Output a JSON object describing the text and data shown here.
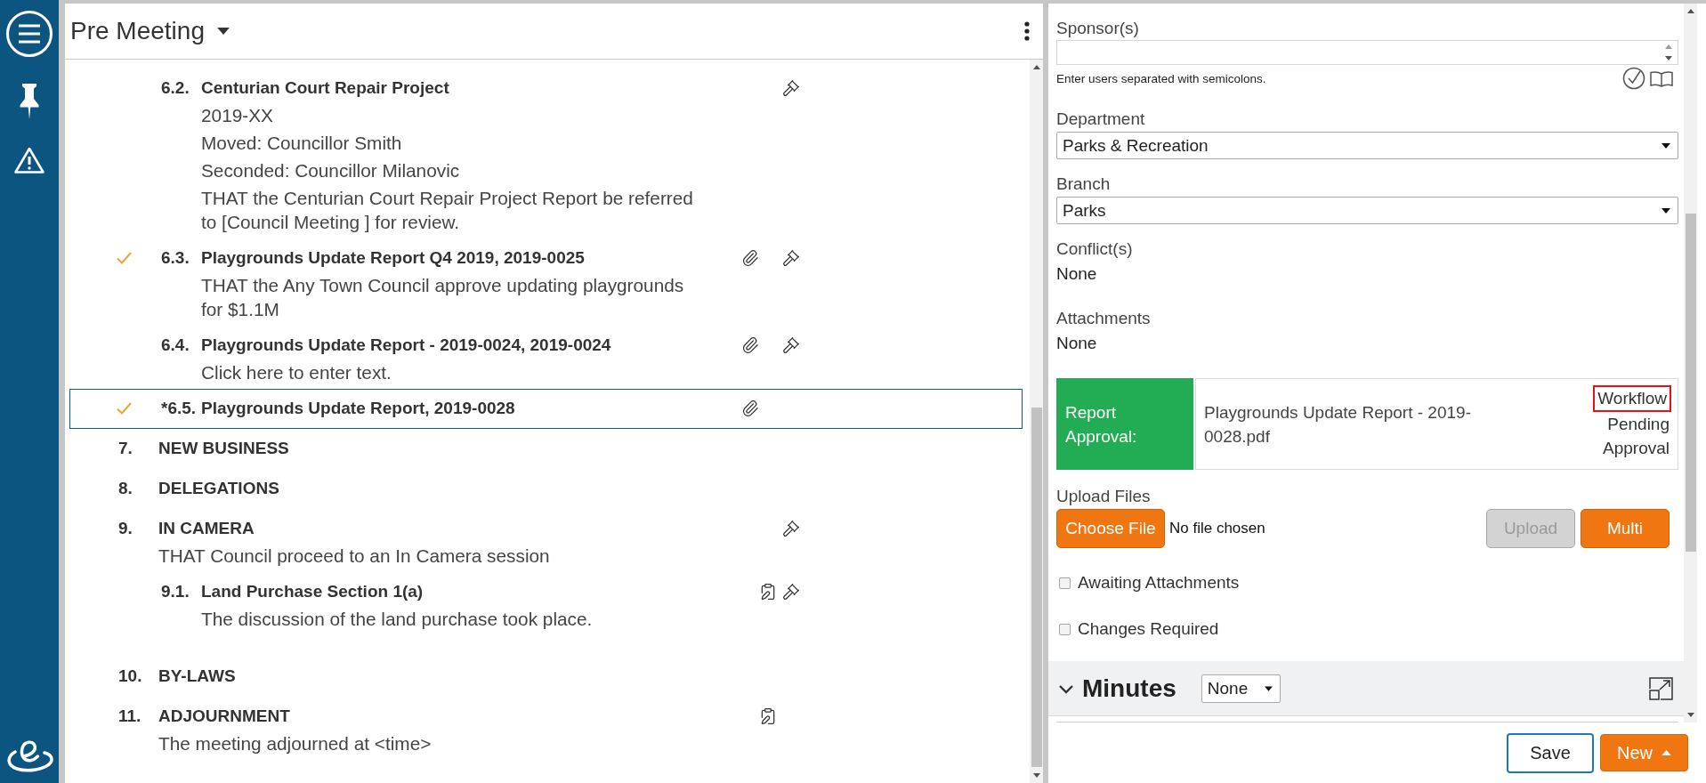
{
  "agenda": {
    "title": "Pre Meeting",
    "continued_subitems": [
      {
        "number": "6.2.",
        "title": "Centurian Court Repair Project",
        "lines": [
          "2019-XX",
          "Moved: Councillor Smith",
          "Seconded: Councillor Milanovic",
          "THAT the Centurian Court Repair Project Report be referred to [Council Meeting ] for review."
        ],
        "checked": false,
        "selected": false,
        "attachment": false,
        "minutes": false,
        "motion": true
      },
      {
        "number": "6.3.",
        "title": "Playgrounds Update Report Q4 2019, 2019-0025",
        "lines": [
          "THAT the Any Town Council approve updating playgrounds for $1.1M"
        ],
        "checked": true,
        "selected": false,
        "attachment": true,
        "minutes": false,
        "motion": true
      },
      {
        "number": "6.4.",
        "title": "Playgrounds Update Report - 2019-0024, 2019-0024",
        "lines": [
          "Click here to enter text."
        ],
        "checked": false,
        "selected": false,
        "attachment": true,
        "minutes": false,
        "motion": true
      },
      {
        "number": "*6.5.",
        "title": "Playgrounds Update Report, 2019-0028",
        "checked": true,
        "selected": true,
        "attachment": true,
        "minutes": false,
        "motion": false
      }
    ],
    "items": [
      {
        "number": "7.",
        "title": "NEW BUSINESS",
        "checked": false,
        "selected": false,
        "attachment": false,
        "minutes": false,
        "motion": false
      },
      {
        "number": "8.",
        "title": "DELEGATIONS",
        "checked": false,
        "selected": false,
        "attachment": false,
        "minutes": false,
        "motion": false
      },
      {
        "number": "9.",
        "title": "IN CAMERA",
        "lines": [
          "THAT Council proceed to an In Camera session"
        ],
        "checked": false,
        "selected": false,
        "attachment": false,
        "minutes": false,
        "motion": true,
        "children": [
          {
            "number": "9.1.",
            "title": "Land Purchase Section 1(a)",
            "lines": [
              "The discussion of the land purchase took place."
            ],
            "checked": false,
            "selected": false,
            "attachment": false,
            "minutes": true,
            "motion": true
          }
        ]
      },
      {
        "number": "10.",
        "title": "BY-LAWS",
        "checked": false,
        "selected": false,
        "attachment": false,
        "minutes": false,
        "motion": false
      },
      {
        "number": "11.",
        "title": "ADJOURNMENT",
        "lines": [
          "The meeting adjourned at <time>"
        ],
        "checked": false,
        "selected": false,
        "attachment": false,
        "minutes": true,
        "motion": false
      }
    ]
  },
  "details": {
    "fields": [
      {
        "kind": "users",
        "label": "Sponsor(s)",
        "hint": "Enter users separated with semicolons."
      },
      {
        "kind": "select",
        "label": "Department",
        "value": "Parks & Recreation"
      },
      {
        "kind": "select",
        "label": "Branch",
        "value": "Parks"
      },
      {
        "kind": "text",
        "label": "Conflict(s)",
        "value": "None"
      },
      {
        "kind": "text",
        "label": "Attachments",
        "value": "None"
      }
    ],
    "approval": {
      "label": "Report Approval:",
      "file": "Playgrounds Update Report - 2019-0028.pdf",
      "workflow": {
        "label": "Workflow",
        "highlighted": true
      },
      "status": "Pending Approval"
    },
    "upload": {
      "label": "Upload Files",
      "choose_button": "Choose File",
      "file_status": "No file chosen",
      "buttons": [
        {
          "label": "Upload",
          "disabled": true
        },
        {
          "label": "Multi",
          "disabled": false
        }
      ]
    },
    "checkboxes": [
      {
        "label": "Awaiting Attachments",
        "checked": false
      },
      {
        "label": "Changes Required",
        "checked": false
      }
    ],
    "minutes": {
      "title": "Minutes",
      "expanded": true,
      "filter": "None"
    }
  },
  "footer": {
    "buttons": [
      {
        "label": "Save",
        "kind": "outline"
      },
      {
        "label": "New",
        "kind": "menu"
      }
    ]
  }
}
